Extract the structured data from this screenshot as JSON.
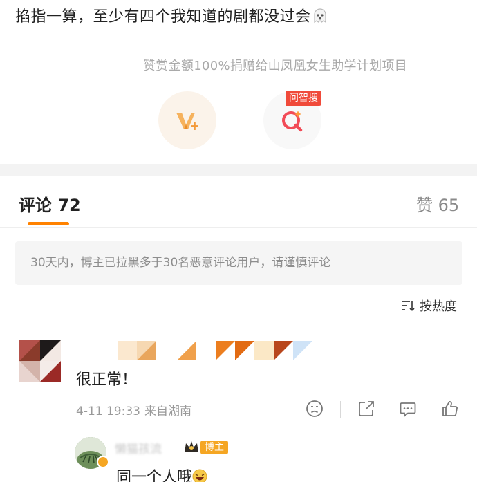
{
  "post": {
    "text": "掐指一算，至少有四个我知道的剧都没过会",
    "emoji": "ghost-icon"
  },
  "reward": {
    "note": "赞赏金额100%捐赠给山凤凰女生助学计划项目",
    "button_icon": "v-plus-icon"
  },
  "search": {
    "badge": "问智搜",
    "icon": "ai-search-icon"
  },
  "tabs": {
    "comments_label": "评论 72",
    "likes_label": "赞 65"
  },
  "notice": {
    "text": "30天内，博主已拉黑多于30名恶意评论用户，请谨慎评论"
  },
  "sort": {
    "label": "按热度",
    "icon": "sort-icon"
  },
  "comment": {
    "text": "很正常！",
    "date": "4-11 19:33",
    "location": "来自湖南",
    "actions": [
      "sad-face-icon",
      "share-icon",
      "reply-icon",
      "like-icon"
    ]
  },
  "reply": {
    "username": "懒猫孩流",
    "tag": "博主",
    "text": "同一个人哦",
    "emoji": "laugh-emoji-icon"
  },
  "colors": {
    "accent": "#ff8200",
    "badge_red": "#f04a3a",
    "blogger_tag": "#f5a623"
  }
}
